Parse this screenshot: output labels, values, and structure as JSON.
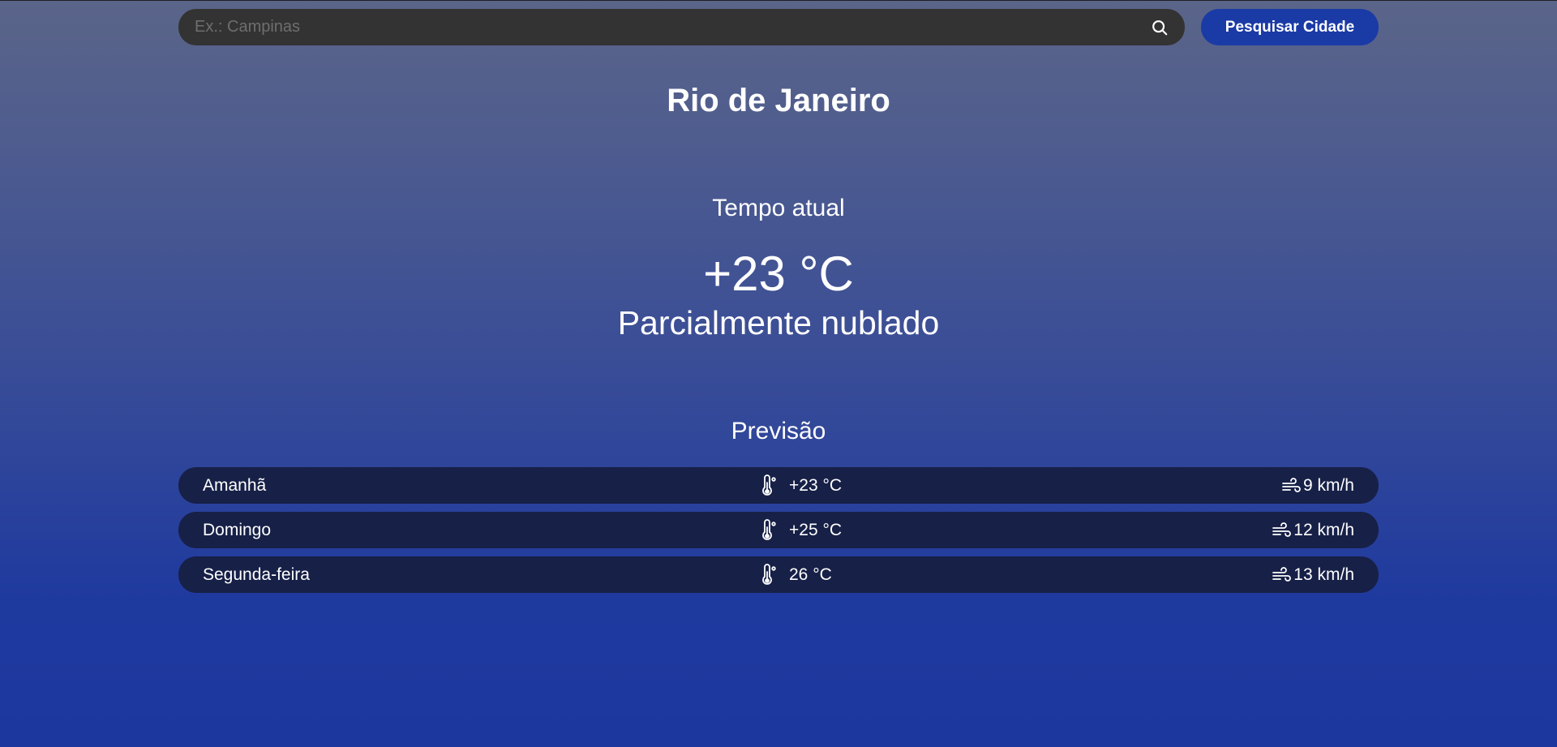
{
  "search": {
    "placeholder": "Ex.: Campinas",
    "value": "",
    "button_label": "Pesquisar Cidade",
    "icon": "search-icon"
  },
  "city": "Rio de Janeiro",
  "current": {
    "label": "Tempo atual",
    "temperature": "+23 °C",
    "description": "Parcialmente nublado"
  },
  "forecast": {
    "title": "Previsão",
    "days": [
      {
        "day": "Amanhã",
        "temperature": "+23 °C",
        "wind": "9 km/h"
      },
      {
        "day": "Domingo",
        "temperature": "+25 °C",
        "wind": "12 km/h"
      },
      {
        "day": "Segunda-feira",
        "temperature": "26 °C",
        "wind": "13 km/h"
      }
    ]
  },
  "colors": {
    "search_bar": "#333333",
    "button": "#1a3aa6",
    "forecast_row": "#172047",
    "gradient_top": "#5b6589",
    "gradient_bottom": "#1c379e"
  }
}
